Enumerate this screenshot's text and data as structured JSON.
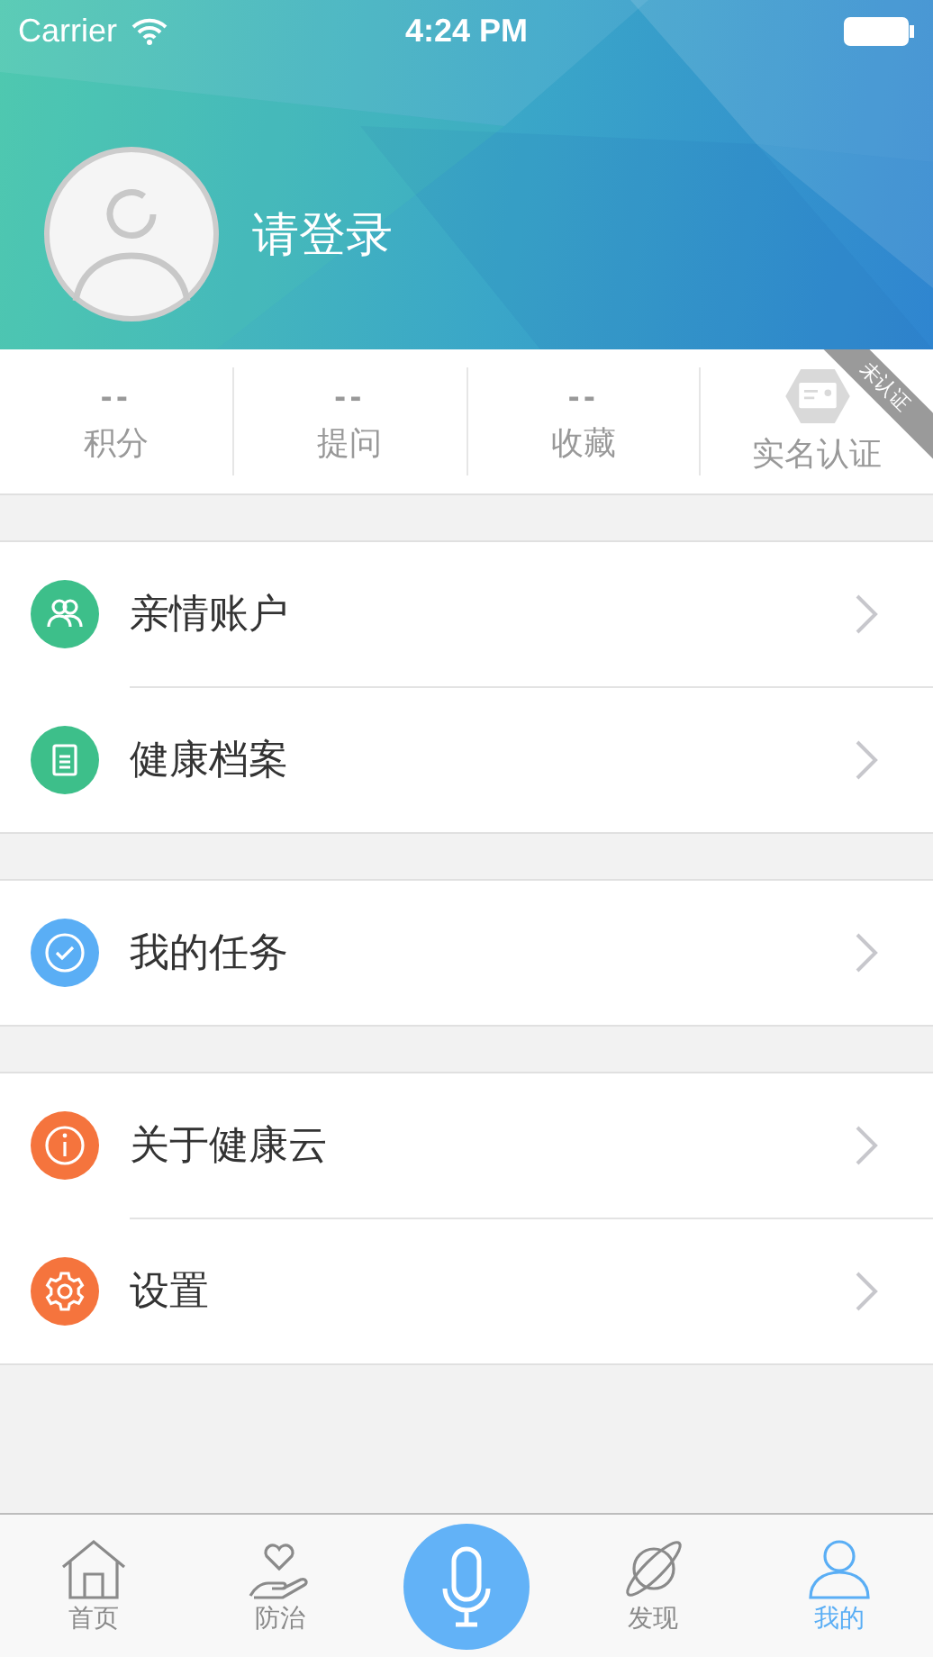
{
  "status_bar": {
    "carrier": "Carrier",
    "time": "4:24 PM"
  },
  "profile": {
    "name": "请登录"
  },
  "stats": [
    {
      "value": "--",
      "label": "积分"
    },
    {
      "value": "--",
      "label": "提问"
    },
    {
      "value": "--",
      "label": "收藏"
    },
    {
      "label": "实名认证",
      "badge": "未认证"
    }
  ],
  "groups": [
    {
      "items": [
        {
          "label": "亲情账户",
          "color": "#3dbf8a"
        },
        {
          "label": "健康档案",
          "color": "#3dbf8a"
        }
      ]
    },
    {
      "items": [
        {
          "label": "我的任务",
          "color": "#5aaef5"
        }
      ]
    },
    {
      "items": [
        {
          "label": "关于健康云",
          "color": "#f5743d"
        },
        {
          "label": "设置",
          "color": "#f5743d"
        }
      ]
    }
  ],
  "tab_bar": [
    {
      "kind": "tab",
      "label": "首页",
      "selected": false
    },
    {
      "kind": "tab",
      "label": "防治",
      "selected": false
    },
    {
      "kind": "voice"
    },
    {
      "kind": "tab",
      "label": "发现",
      "selected": false
    },
    {
      "kind": "tab",
      "label": "我的",
      "selected": true
    }
  ]
}
